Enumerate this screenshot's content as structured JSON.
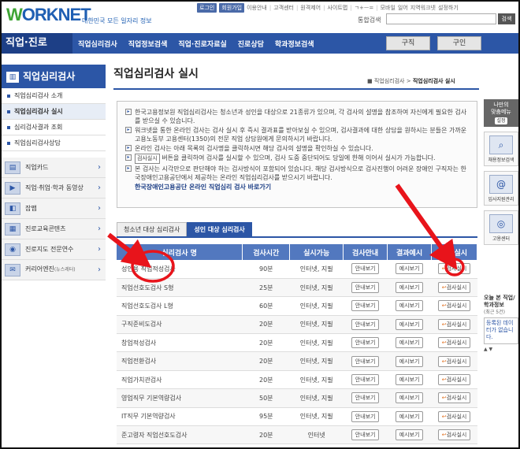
{
  "header": {
    "logo_w": "W",
    "logo_rest": "ORKNET",
    "slogan": "대한민국 모든 일자리 정보",
    "util": [
      "로그인",
      "회원가입",
      "이용안내",
      "고객센터",
      "원격제어",
      "사이트맵",
      "ㄱ+ㅡ=",
      "모바일",
      "일어",
      "지역워크넷",
      "설정하기"
    ],
    "search_label": "통합검색",
    "search_placeholder": "",
    "search_button": "검색"
  },
  "nav": {
    "brand": "직업·진로",
    "items": [
      "직업심리검사",
      "직업정보검색",
      "직업·진로자료실",
      "진로상담",
      "학과정보검색"
    ],
    "job": "구직",
    "hire": "구인"
  },
  "sidebar": {
    "title": "직업심리검사",
    "subs": [
      "직업심리검사 소개",
      "직업심리검사 실시",
      "심리검사결과 조회",
      "직업심리검사상담"
    ],
    "links": [
      "직업카드",
      "직업·취업·학과 동영상",
      "잡맵",
      "진로교육콘텐츠",
      "진로지도 전문연수",
      "커리어엔진"
    ],
    "link_suffix": "(뉴스레터)"
  },
  "main": {
    "title": "직업심리검사 실시",
    "breadcrumb_prefix": "직업심리검사 >",
    "breadcrumb_current": "직업심리검사 실시",
    "notices": [
      "한국고용정보원 직업심리검사는 청소년과 성인을 대상으로 21종류가 있으며, 각 검사의 설명을 참조하여 자신에게 필요한 검사를 받으실 수 있습니다.",
      "워크넷을 통한 온라인 검사는 검사 실시 후 즉시 결과표를 받아보실 수 있으며, 검사결과에 대한 상담을 원하시는 분들은 가까운 고용노동부 고용센터(1350)의 전문 직업 상담원에게 문의하시기 바랍니다.",
      "온라인 검사는 아래 목록의 검사명을 클릭하시면 해당 검사의 설명을 확인하실 수 있습니다.",
      "버튼을 클릭하여 검사를 실시할 수 있으며, 검사 도중 중단되어도 당일에 한해 이어서 실시가 가능합니다.",
      "본 검사는 시각만으로 판단해야 하는 검사방식이 포함되어 있습니다. 해당 검사방식으로 검사진행이 어려운 장애인 구직자는 한국장애인고용공단에서 제공하는 온라인 직업심리검사를 받으시기 바랍니다."
    ],
    "chip": "검사실시",
    "notice_link": "한국장애인고용공단 온라인 직업심리 검사 바로가기",
    "tabs": [
      "청소년 대상 심리검사",
      "성인 대상 심리검사"
    ],
    "columns": [
      "심리검사 명",
      "검사시간",
      "실시가능",
      "검사안내",
      "결과예시",
      "검사실시"
    ],
    "guide_btn": "안내보기",
    "example_btn": "예시보기",
    "run_btn": "검사실시",
    "rows": [
      {
        "name": "성인용 직업적성검사",
        "time": "90분",
        "avail": "인터넷, 지필"
      },
      {
        "name": "직업선호도검사 S형",
        "time": "25분",
        "avail": "인터넷, 지필"
      },
      {
        "name": "직업선호도검사 L형",
        "time": "60분",
        "avail": "인터넷, 지필"
      },
      {
        "name": "구직준비도검사",
        "time": "20분",
        "avail": "인터넷, 지필"
      },
      {
        "name": "창업적성검사",
        "time": "20분",
        "avail": "인터넷, 지필"
      },
      {
        "name": "직업전환검사",
        "time": "20분",
        "avail": "인터넷, 지필"
      },
      {
        "name": "직업가치관검사",
        "time": "20분",
        "avail": "인터넷, 지필"
      },
      {
        "name": "영업직무 기본역량검사",
        "time": "50분",
        "avail": "인터넷, 지필"
      },
      {
        "name": "IT직무 기본역량검사",
        "time": "95분",
        "avail": "인터넷, 지필"
      },
      {
        "name": "준고령자 직업선호도검사",
        "time": "20분",
        "avail": "인터넷"
      }
    ]
  },
  "rail": {
    "head1": "나만의",
    "head2": "맞춤메뉴",
    "set": "설정",
    "items": [
      "채용정보검색",
      "입사지원관리",
      "고용센터"
    ],
    "news_title": "오늘 본 직업/학과정보",
    "news_count": "(최근 5건)",
    "news_box": "등록된 데이터가 없습니다."
  },
  "colors": {
    "primary": "#2c56a6",
    "annotation": "#e8141b"
  }
}
